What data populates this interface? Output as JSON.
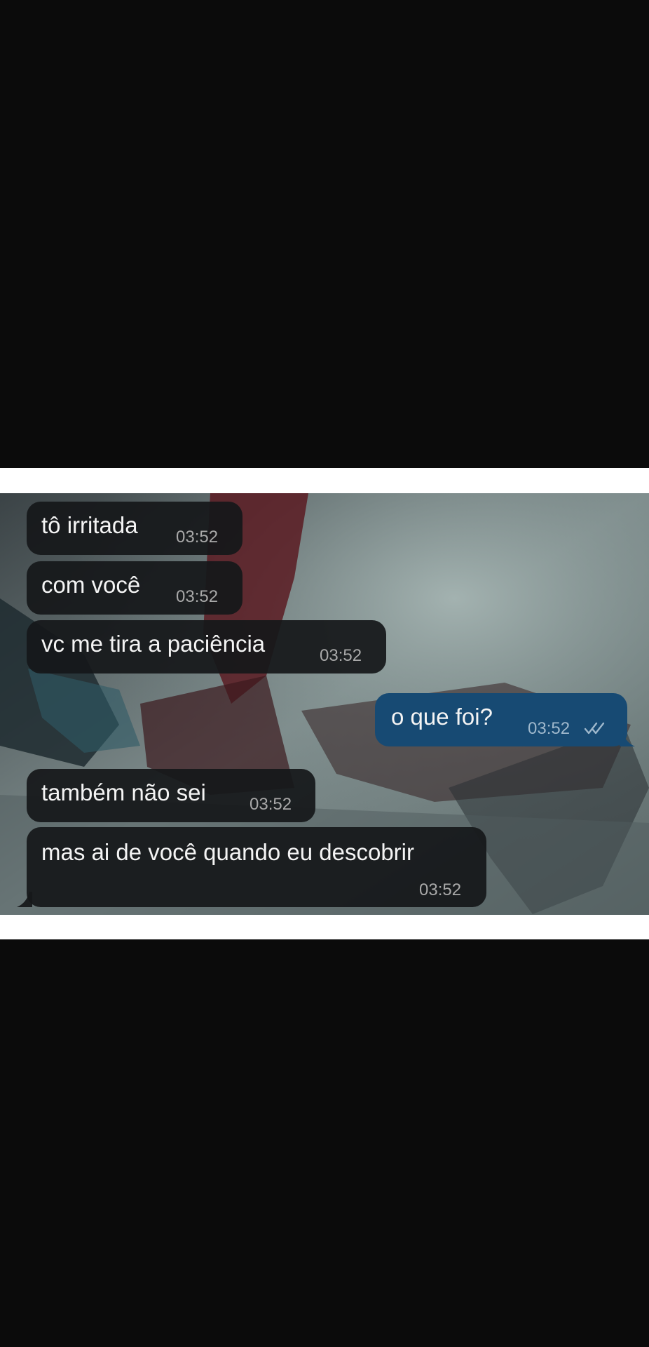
{
  "messages": [
    {
      "text": "tô irritada",
      "time": "03:52",
      "direction": "incoming"
    },
    {
      "text": "com você",
      "time": "03:52",
      "direction": "incoming"
    },
    {
      "text": "vc me tira a paciência",
      "time": "03:52",
      "direction": "incoming"
    },
    {
      "text": "o que foi?",
      "time": "03:52",
      "direction": "outgoing",
      "status": "read-double-check-icon"
    },
    {
      "text": "também não sei",
      "time": "03:52",
      "direction": "incoming"
    },
    {
      "text": "mas ai de você quando eu descobrir",
      "time": "03:52",
      "direction": "incoming"
    }
  ],
  "colors": {
    "page_background": "#0b0b0b",
    "band": "#ffffff",
    "incoming_bubble": "#16181a",
    "outgoing_bubble": "#174a73",
    "message_text": "#f4f4f4",
    "timestamp": "#a9a9a9"
  }
}
